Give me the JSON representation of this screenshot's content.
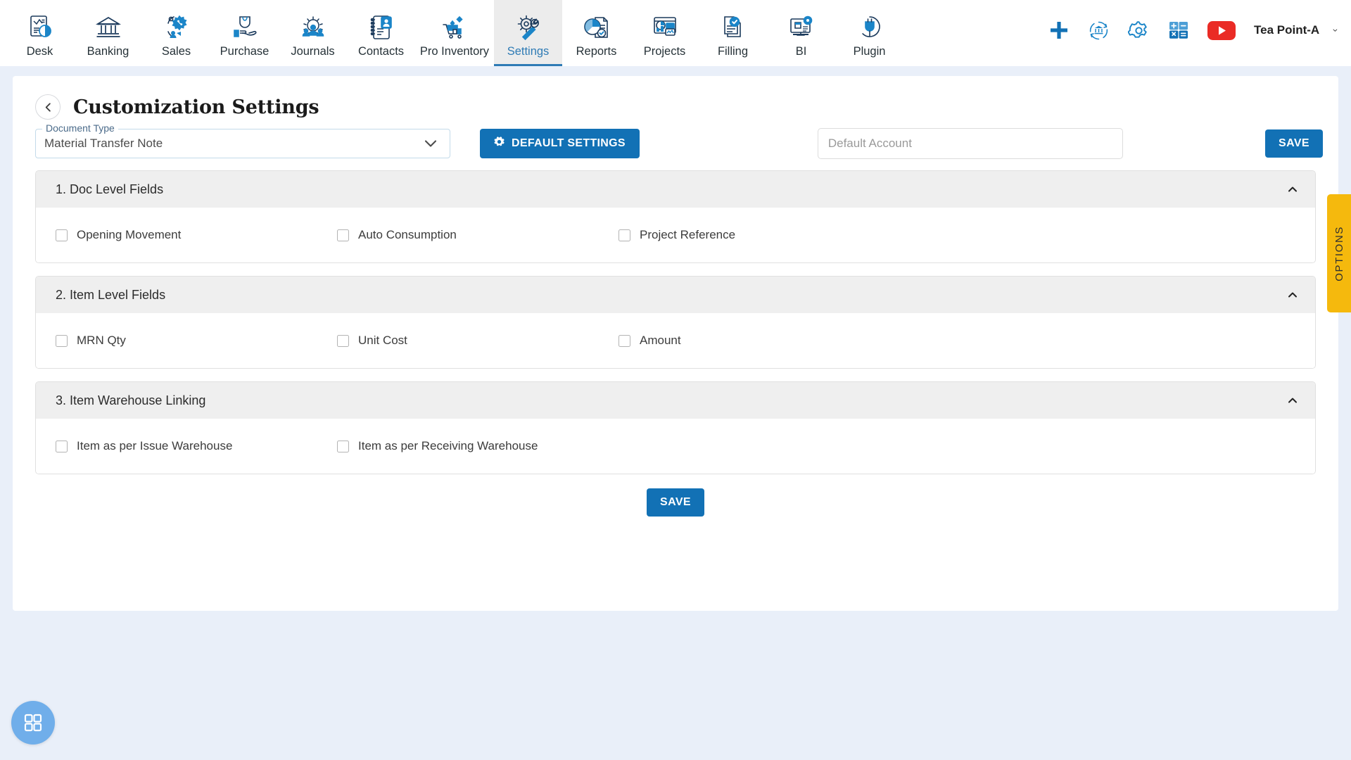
{
  "nav": {
    "items": [
      {
        "label": "Desk",
        "icon": "desk-dashboard-icon",
        "active": false
      },
      {
        "label": "Banking",
        "icon": "bank-icon",
        "active": false
      },
      {
        "label": "Sales",
        "icon": "sales-tag-icon",
        "active": false
      },
      {
        "label": "Purchase",
        "icon": "purchase-hand-icon",
        "active": false
      },
      {
        "label": "Journals",
        "icon": "journals-gear-people-icon",
        "active": false
      },
      {
        "label": "Contacts",
        "icon": "contacts-book-icon",
        "active": false
      },
      {
        "label": "Pro Inventory",
        "icon": "inventory-cart-icon",
        "active": false
      },
      {
        "label": "Settings",
        "icon": "settings-gear-wrench-icon",
        "active": true
      },
      {
        "label": "Reports",
        "icon": "reports-piechart-icon",
        "active": false
      },
      {
        "label": "Projects",
        "icon": "projects-board-icon",
        "active": false
      },
      {
        "label": "Filling",
        "icon": "filling-check-docs-icon",
        "active": false
      },
      {
        "label": "BI",
        "icon": "bi-monitor-gear-icon",
        "active": false
      },
      {
        "label": "Plugin",
        "icon": "plugin-plug-icon",
        "active": false
      }
    ],
    "actions": [
      {
        "name": "add-new-icon"
      },
      {
        "name": "bank-sync-icon"
      },
      {
        "name": "settings-gear-icon"
      },
      {
        "name": "calculator-icon"
      },
      {
        "name": "youtube-icon"
      }
    ],
    "user": {
      "name": "Tea Point-A"
    }
  },
  "header": {
    "title": "Customization Settings",
    "back_icon": "chevron-left-icon"
  },
  "toolbar": {
    "document_type_label": "Document Type",
    "document_type_value": "Material Transfer Note",
    "default_settings_label": "DEFAULT SETTINGS",
    "default_account_placeholder": "Default Account",
    "default_account_value": "",
    "save_label": "SAVE"
  },
  "options_tab": {
    "label": "OPTIONS"
  },
  "sections": [
    {
      "title": "1. Doc Level Fields",
      "collapse_icon": "chevron-up-icon",
      "fields": [
        {
          "label": "Opening Movement",
          "checked": false
        },
        {
          "label": "Auto Consumption",
          "checked": false
        },
        {
          "label": "Project Reference",
          "checked": false
        }
      ]
    },
    {
      "title": "2. Item Level Fields",
      "collapse_icon": "chevron-up-icon",
      "fields": [
        {
          "label": "MRN Qty",
          "checked": false
        },
        {
          "label": "Unit Cost",
          "checked": false
        },
        {
          "label": "Amount",
          "checked": false
        }
      ]
    },
    {
      "title": "3. Item Warehouse Linking",
      "collapse_icon": "chevron-up-icon",
      "fields": [
        {
          "label": "Item as per Issue Warehouse",
          "checked": false
        },
        {
          "label": "Item as per Receiving Warehouse",
          "checked": false
        }
      ]
    }
  ],
  "footer": {
    "save_label": "SAVE"
  },
  "fab": {
    "icon": "grid-apps-icon"
  },
  "colors": {
    "accent_blue": "#1271b5",
    "nav_blue": "#2e7bb5",
    "options_yellow": "#f5b90d",
    "page_bg": "#e9eff9",
    "section_head": "#efefef",
    "fab_blue": "#70aeea",
    "youtube_red": "#ea2b25"
  }
}
